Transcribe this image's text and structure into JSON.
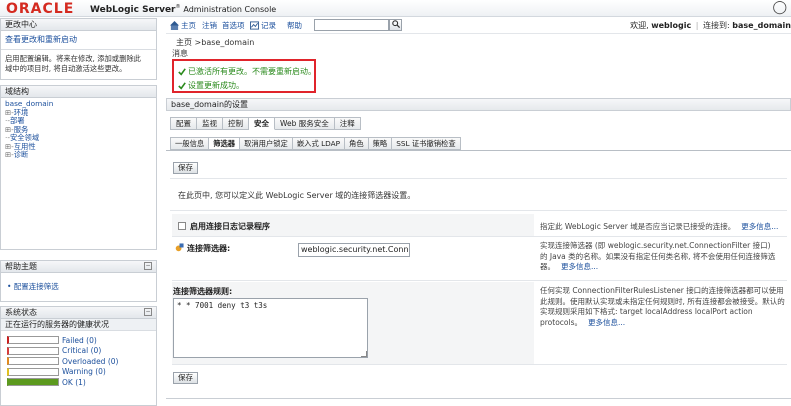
{
  "header": {
    "logo": "ORACLE",
    "product": "WebLogic Server",
    "product_sup": "®",
    "product_sub": "Administration Console"
  },
  "toolbar": {
    "home": "主页",
    "logout": "注销",
    "preferences": "首选项",
    "record": "记录",
    "help": "帮助",
    "search_value": "",
    "welcome_prefix": "欢迎,",
    "user": "weblogic",
    "connected_prefix": "连接到:",
    "domain": "base_domain"
  },
  "change_center": {
    "title": "更改中心",
    "link": "查看更改和重新启动",
    "body_line1": "启用配置编辑。将来在修改, 添加或删除此",
    "body_line2": "域中的项目时, 将自动激活这些更改。"
  },
  "domain_structure": {
    "title": "域结构",
    "tree": [
      {
        "label": "base_domain",
        "prefix": ""
      },
      {
        "label": "环境",
        "prefix": "⊞-"
      },
      {
        "label": "部署",
        "prefix": "·-"
      },
      {
        "label": "服务",
        "prefix": "⊞-"
      },
      {
        "label": "安全领域",
        "prefix": "·-"
      },
      {
        "label": "互用性",
        "prefix": "⊞-"
      },
      {
        "label": "诊断",
        "prefix": "⊞-"
      }
    ]
  },
  "help_topics": {
    "title": "帮助主题",
    "link": "• 配置连接筛选"
  },
  "system_status": {
    "title": "系统状态",
    "subtitle": "正在运行的服务器的健康状况",
    "rows": [
      {
        "label": "Failed (0)",
        "fill": 0,
        "color": "#c91f1f"
      },
      {
        "label": "Critical (0)",
        "fill": 0,
        "color": "#d63b3b"
      },
      {
        "label": "Overloaded (0)",
        "fill": 0,
        "color": "#e08a1f"
      },
      {
        "label": "Warning (0)",
        "fill": 0,
        "color": "#e0c01f"
      },
      {
        "label": "OK (1)",
        "fill": 1,
        "color": "#5c9a1e"
      }
    ]
  },
  "breadcrumb": "主页 >base_domain",
  "messages": {
    "label": "消息",
    "items": [
      "已激活所有更改。不需要重新启动。",
      "设置更新成功。"
    ],
    "highlight_color": "#e0242b"
  },
  "settings": {
    "title": "base_domain的设置",
    "tabs": [
      "配置",
      "监视",
      "控制",
      "安全",
      "Web 服务安全",
      "注释"
    ],
    "active_tab": 3,
    "subtabs": [
      "一般信息",
      "筛选器",
      "取消用户锁定",
      "嵌入式 LDAP",
      "角色",
      "策略",
      "SSL 证书撤销检查"
    ],
    "active_subtab": 1,
    "save_label": "保存",
    "description": "在此页中, 您可以定义此 WebLogic Server 域的连接筛选器设置。",
    "log_label": "启用连接日志记录程序",
    "log_help": "指定此 WebLogic Server 域是否应当记录已接受的连接。",
    "more": "更多信息...",
    "conn_label": "连接筛选器:",
    "conn_value": "weblogic.security.net.Connec",
    "conn_help": "实现连接筛选器 (即 weblogic.security.net.ConnectionFilter 接口) 的 Java 类的名称。如果没有指定任何类名称, 将不会使用任何连接筛选器。",
    "rules_label": "连接筛选器规则:",
    "rules_value": "* * 7001 deny t3 t3s",
    "rules_help": "任何实现 ConnectionFilterRulesListener 接口的连接筛选器都可以使用此规则。使用默认实现或未指定任何规则时, 所有连接都会被接受。默认的实现规则采用如下格式: target localAddress localPort action protocols。"
  }
}
